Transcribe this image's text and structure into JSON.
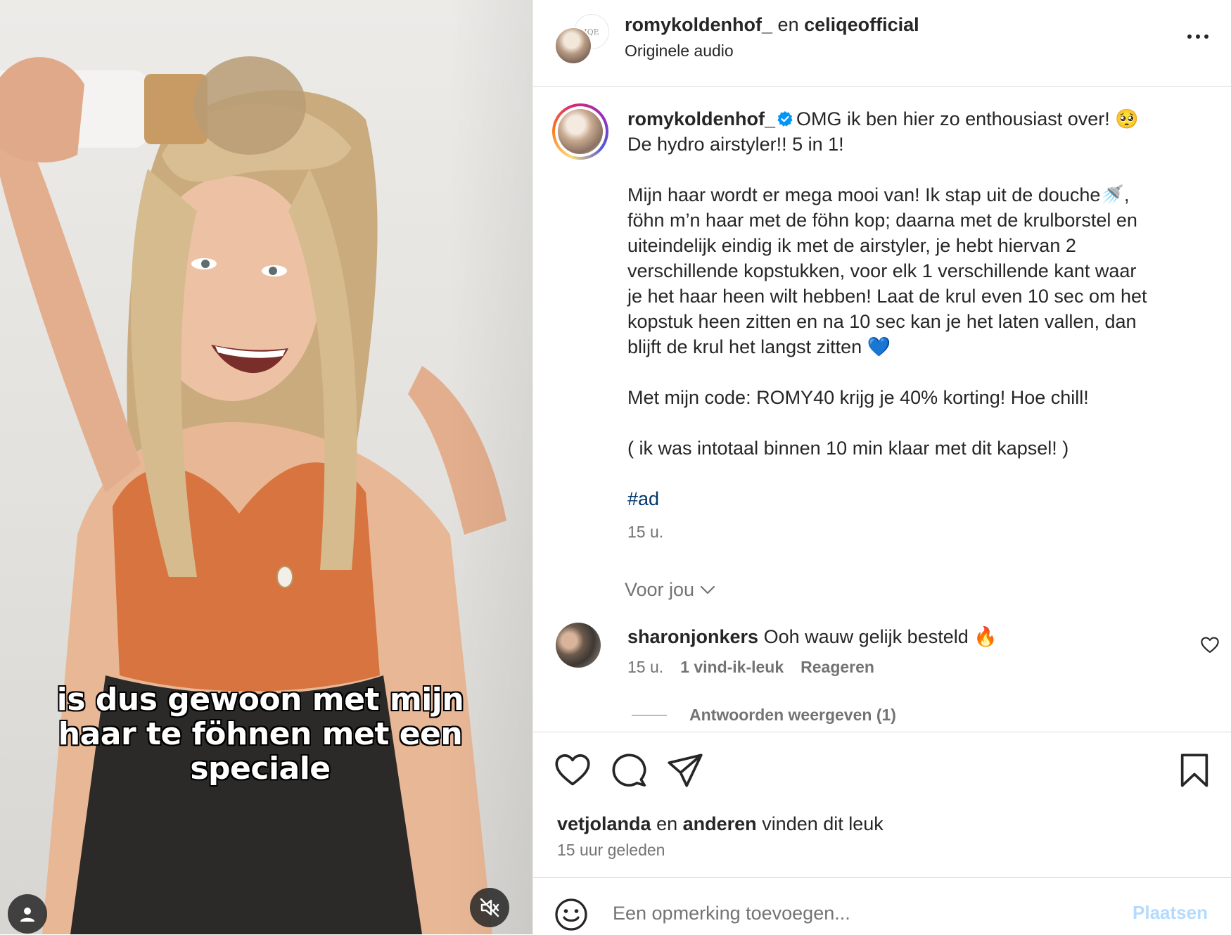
{
  "media": {
    "caption_lines": [
      "is dus gewoon met mijn",
      "haar te föhnen met een",
      "speciale"
    ]
  },
  "header": {
    "user1": "romykoldenhof_",
    "connector": "en",
    "user2": "celiqeofficial",
    "audio": "Originele audio",
    "brand_mark": "IQE"
  },
  "post": {
    "username": "romykoldenhof_",
    "line1": "OMG ik ben hier zo enthousiast over! 🥺",
    "line2": "De hydro airstyler!! 5 in 1!",
    "paragraph2": "Mijn haar wordt er mega mooi van! Ik stap uit de douche🚿,\nföhn m’n haar met de föhn kop; daarna met de krulborstel en\nuiteindelijk eindig ik met de airstyler, je hebt hiervan 2\nverschillende kopstukken, voor elk 1 verschillende kant waar\nje het haar heen wilt hebben! Laat de krul even 10 sec om het\nkopstuk heen zitten en na 10 sec kan je het laten vallen, dan\nblijft de krul het langst zitten 💙",
    "paragraph3": "Met mijn code: ROMY40 krijg je 40% korting! Hoe chill!",
    "paragraph4": "( ik was intotaal binnen 10 min klaar met dit kapsel! )",
    "hashtag": "#ad",
    "time": "15 u."
  },
  "for_you": "Voor jou",
  "comment": {
    "username": "sharonjonkers",
    "text": "Ooh wauw gelijk besteld 🔥",
    "time": "15 u.",
    "likes": "1 vind-ik-leuk",
    "reply": "Reageren",
    "view_replies": "Antwoorden weergeven (1)"
  },
  "likes": {
    "user": "vetjolanda",
    "connector": "en",
    "others": "anderen",
    "suffix": "vinden dit leuk",
    "time": "15 uur geleden"
  },
  "add_comment": {
    "placeholder": "Een opmerking toevoegen...",
    "post_label": "Plaatsen"
  },
  "colors": {
    "link": "#00376b",
    "muted": "#737373",
    "post_button": "#b3dbff",
    "verified": "#0095f6"
  },
  "icons": [
    "more-icon",
    "verified-icon",
    "chevron-down-icon",
    "heart-icon",
    "comment-icon",
    "share-icon",
    "bookmark-icon",
    "emoji-icon",
    "user-icon",
    "mute-icon"
  ]
}
